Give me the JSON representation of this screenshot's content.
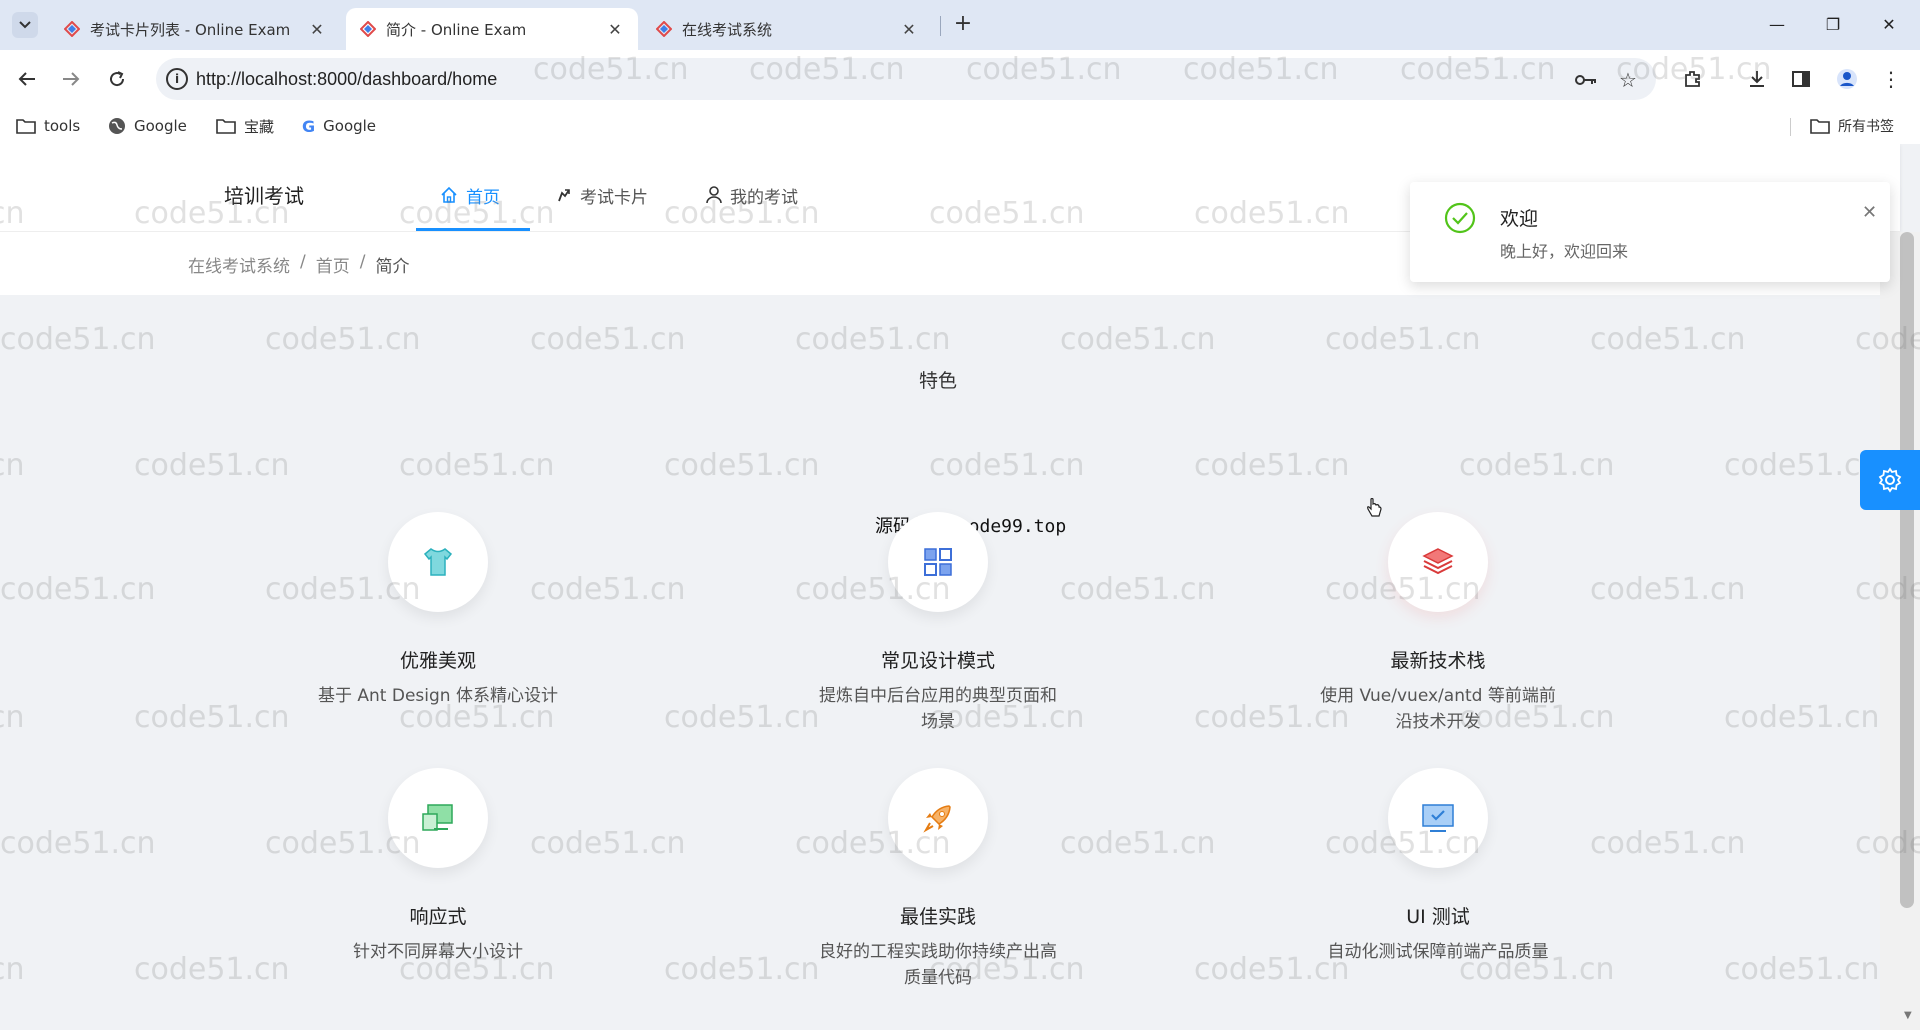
{
  "browser": {
    "tabs": [
      {
        "title": "考试卡片列表 - Online Exam",
        "active": false
      },
      {
        "title": "简介 - Online Exam",
        "active": true
      },
      {
        "title": "在线考试系统",
        "active": false
      }
    ],
    "url": "http://localhost:8000/dashboard/home",
    "bookmarks": [
      {
        "label": "tools",
        "icon": "folder-icon"
      },
      {
        "label": "Google",
        "icon": "globe-icon"
      },
      {
        "label": "宝藏",
        "icon": "folder-icon"
      },
      {
        "label": "Google",
        "icon": "google-icon"
      }
    ],
    "all_bookmarks_label": "所有书签"
  },
  "header": {
    "logo": "培训考试",
    "menu": [
      {
        "label": "首页",
        "icon": "home-icon",
        "active": true
      },
      {
        "label": "考试卡片",
        "icon": "card-icon",
        "active": false
      },
      {
        "label": "我的考试",
        "icon": "user-icon",
        "active": false
      }
    ]
  },
  "breadcrumb": [
    "在线考试系统",
    "首页",
    "简介"
  ],
  "features_title": "特色",
  "overlay_text": "源码久久-code99.top",
  "features": [
    {
      "title": "优雅美观",
      "desc": "基于 Ant Design 体系精心设计",
      "icon": "shirt-icon"
    },
    {
      "title": "常见设计模式",
      "desc": "提炼自中后台应用的典型页面和场景",
      "icon": "appstore-icon"
    },
    {
      "title": "最新技术栈",
      "desc": "使用 Vue/vuex/antd 等前端前沿技术开发",
      "icon": "layers-icon"
    },
    {
      "title": "响应式",
      "desc": "针对不同屏幕大小设计",
      "icon": "responsive-icon"
    },
    {
      "title": "最佳实践",
      "desc": "良好的工程实践助你持续产出高质量代码",
      "icon": "rocket-icon"
    },
    {
      "title": "UI 测试",
      "desc": "自动化测试保障前端产品质量",
      "icon": "monitor-check-icon"
    }
  ],
  "notification": {
    "title": "欢迎",
    "message": "晚上好，欢迎回来"
  },
  "watermark": "code51.cn",
  "colors": {
    "primary": "#1890ff",
    "success": "#52c41a",
    "page_bg": "#f0f2f5"
  }
}
